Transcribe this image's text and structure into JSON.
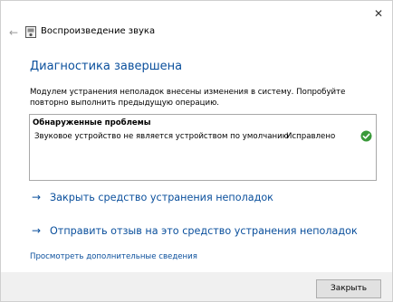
{
  "window": {
    "title": "Воспроизведение звука",
    "close_glyph": "✕",
    "back_glyph": "←",
    "icon": "speaker-app-icon"
  },
  "main": {
    "heading": "Диагностика завершена",
    "description": "Модулем устранения неполадок внесены изменения в систему. Попробуйте повторно выполнить предыдущую операцию.",
    "problems": {
      "header": "Обнаруженные проблемы",
      "rows": [
        {
          "description": "Звуковое устройство не является устройством по умолчанию",
          "status": "Исправлено",
          "status_icon": "check-icon"
        }
      ]
    },
    "links": {
      "close_troubleshooter": "Закрыть средство устранения неполадок",
      "send_feedback": "Отправить отзыв на это средство устранения неполадок",
      "arrow_glyph": "→",
      "more_info": "Просмотреть дополнительные сведения"
    }
  },
  "footer": {
    "close_button": "Закрыть"
  },
  "colors": {
    "accent": "#0a4f9c",
    "success": "#3a9a3a",
    "footer_bg": "#f0f0f0"
  }
}
